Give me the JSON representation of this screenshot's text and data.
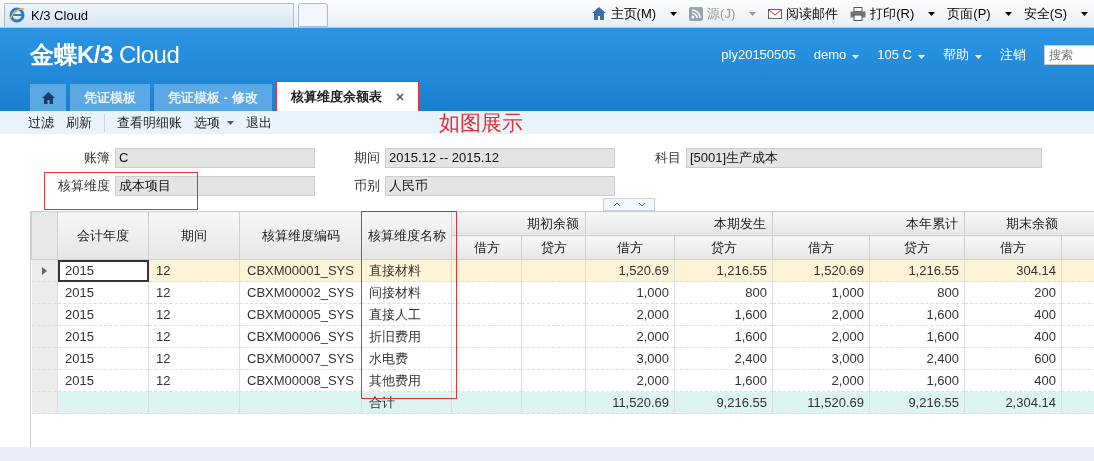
{
  "browser": {
    "tab_title": "K/3 Cloud",
    "commands": [
      {
        "kind": "home",
        "label": "主页(M)",
        "dropdown": true,
        "disabled": false
      },
      {
        "kind": "feed",
        "label": "源(J)",
        "dropdown": true,
        "disabled": true
      },
      {
        "kind": "mail",
        "label": "阅读邮件",
        "dropdown": false,
        "disabled": false
      },
      {
        "kind": "print",
        "label": "打印(R)",
        "dropdown": true,
        "disabled": false
      },
      {
        "kind": "text",
        "label": "页面(P)",
        "dropdown": true,
        "disabled": false
      },
      {
        "kind": "text",
        "label": "安全(S)",
        "dropdown": true,
        "disabled": false
      }
    ]
  },
  "app": {
    "logo": "**金蝶K/3** *Cloud*",
    "user_menu": [
      {
        "label": "ply20150505",
        "dropdown": false
      },
      {
        "label": "demo",
        "dropdown": true
      },
      {
        "label": "105 C",
        "dropdown": true
      },
      {
        "label": "帮助",
        "dropdown": true
      },
      {
        "label": "注销",
        "dropdown": false
      }
    ],
    "search": {
      "placeholder": "搜索"
    }
  },
  "tabs": [
    {
      "kind": "home",
      "selected": false,
      "closable": false,
      "highlighted": false
    },
    {
      "kind": "text",
      "label": "凭证模板",
      "selected": false,
      "closable": false,
      "highlighted": false
    },
    {
      "kind": "text",
      "label": "凭证模板 - 修改",
      "selected": false,
      "closable": false,
      "highlighted": false
    },
    {
      "kind": "text",
      "label": "核算维度余额表",
      "selected": true,
      "closable": true,
      "highlighted": true
    }
  ],
  "toolbar": [
    {
      "label": "过滤",
      "separator_before": false,
      "dropdown": false
    },
    {
      "label": "刷新",
      "separator_before": false,
      "dropdown": false
    },
    {
      "label": "查看明细账",
      "separator_before": true,
      "dropdown": false
    },
    {
      "label": "选项",
      "separator_before": false,
      "dropdown": true
    },
    {
      "label": "退出",
      "separator_before": false,
      "dropdown": false
    }
  ],
  "annotation": "如图展示",
  "form": [
    {
      "label": "账簿",
      "value": "C",
      "highlighted": false
    },
    {
      "label": "期间",
      "value": "2015.12 -- 2015.12",
      "highlighted": false
    },
    {
      "label": "科目",
      "value": "[5001]生产成本",
      "highlighted": false
    },
    {
      "label": "核算维度",
      "value": "成本项目",
      "highlighted": true
    },
    {
      "label": "币别",
      "value": "人民币",
      "highlighted": false
    }
  ],
  "grid": {
    "columns": [
      {
        "label": "会计年度",
        "highlighted": false
      },
      {
        "label": "期间",
        "highlighted": false
      },
      {
        "label": "核算维度编码",
        "highlighted": false
      },
      {
        "label": "核算维度名称",
        "highlighted": true
      }
    ],
    "column_groups": [
      {
        "label": "期初余额",
        "sub": [
          "借方",
          "贷方"
        ]
      },
      {
        "label": "本期发生",
        "sub": [
          "借方",
          "贷方"
        ]
      },
      {
        "label": "本年累计",
        "sub": [
          "借方",
          "贷方"
        ]
      },
      {
        "label": "期末余额",
        "sub": [
          "借方"
        ]
      }
    ],
    "rows": [
      {
        "kind": "data",
        "selected": true,
        "cells": [
          "2015",
          "12",
          "CBXM00001_SYS",
          "直接材料",
          null,
          null,
          "1,520.69",
          "1,216.55",
          "1,520.69",
          "1,216.55",
          "304.14",
          null
        ]
      },
      {
        "kind": "data",
        "selected": false,
        "cells": [
          "2015",
          "12",
          "CBXM00002_SYS",
          "间接材料",
          null,
          null,
          "1,000",
          "800",
          "1,000",
          "800",
          "200",
          null
        ]
      },
      {
        "kind": "data",
        "selected": false,
        "cells": [
          "2015",
          "12",
          "CBXM00005_SYS",
          "直接人工",
          null,
          null,
          "2,000",
          "1,600",
          "2,000",
          "1,600",
          "400",
          null
        ]
      },
      {
        "kind": "data",
        "selected": false,
        "cells": [
          "2015",
          "12",
          "CBXM00006_SYS",
          "折旧费用",
          null,
          null,
          "2,000",
          "1,600",
          "2,000",
          "1,600",
          "400",
          null
        ]
      },
      {
        "kind": "data",
        "selected": false,
        "cells": [
          "2015",
          "12",
          "CBXM00007_SYS",
          "水电费",
          null,
          null,
          "3,000",
          "2,400",
          "3,000",
          "2,400",
          "600",
          null
        ]
      },
      {
        "kind": "data",
        "selected": false,
        "cells": [
          "2015",
          "12",
          "CBXM00008_SYS",
          "其他费用",
          null,
          null,
          "2,000",
          "1,600",
          "2,000",
          "1,600",
          "400",
          null
        ]
      },
      {
        "kind": "total",
        "selected": false,
        "cells": [
          null,
          null,
          null,
          "合计",
          null,
          null,
          "11,520.69",
          "9,216.55",
          "11,520.69",
          "9,216.55",
          "2,304.14",
          null
        ]
      }
    ]
  }
}
